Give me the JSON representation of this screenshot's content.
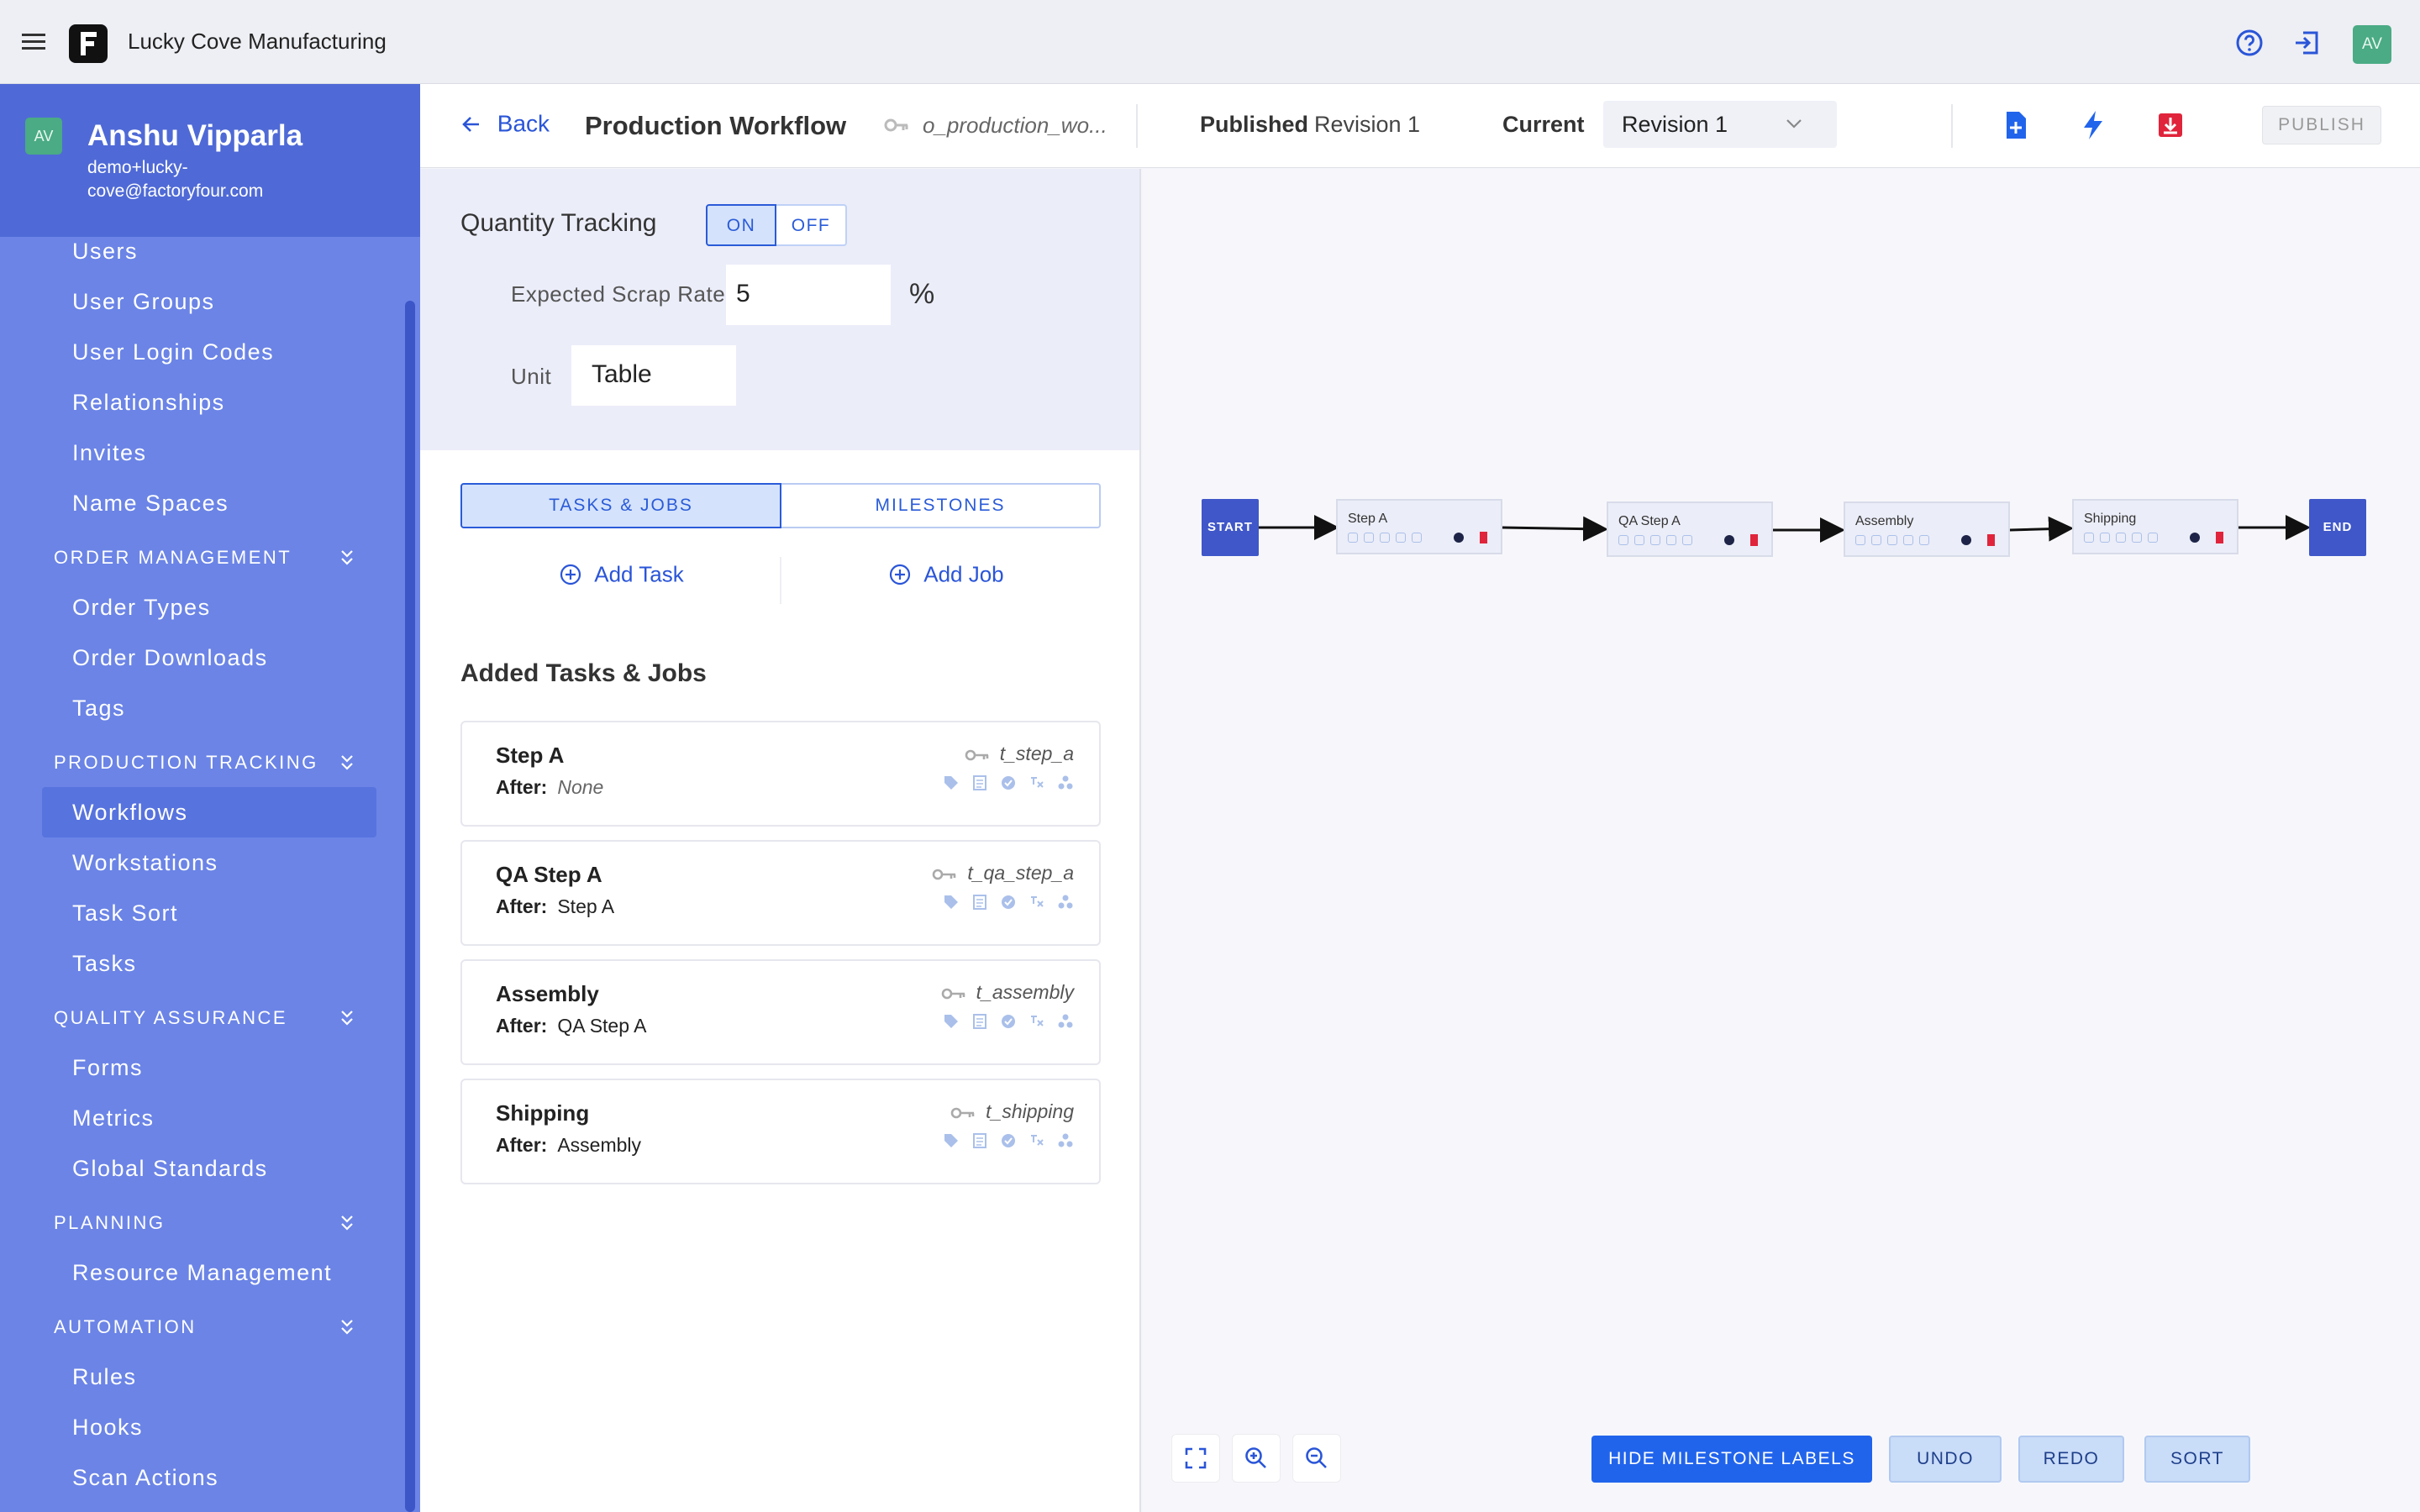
{
  "topbar": {
    "company": "Lucky Cove Manufacturing",
    "logo_letter": "F",
    "avatar_initials": "AV",
    "icons": [
      "hamburger-menu-icon",
      "help-icon",
      "logout-icon"
    ]
  },
  "user": {
    "initials": "AV",
    "name": "Anshu Vipparla",
    "email": "demo+lucky-cove@factoryfour.com"
  },
  "sidebar": {
    "items_top": [
      "Users",
      "User Groups",
      "User Login Codes",
      "Relationships",
      "Invites",
      "Name Spaces"
    ],
    "order_management": {
      "title": "ORDER MANAGEMENT",
      "items": [
        "Order Types",
        "Order Downloads",
        "Tags"
      ]
    },
    "production_tracking": {
      "title": "PRODUCTION TRACKING",
      "items": [
        "Workflows",
        "Workstations",
        "Task Sort",
        "Tasks"
      ],
      "active": "Workflows"
    },
    "quality_assurance": {
      "title": "QUALITY ASSURANCE",
      "items": [
        "Forms",
        "Metrics",
        "Global Standards"
      ]
    },
    "planning": {
      "title": "PLANNING",
      "items": [
        "Resource Management"
      ]
    },
    "automation": {
      "title": "AUTOMATION",
      "items": [
        "Rules",
        "Hooks",
        "Scan Actions"
      ]
    }
  },
  "header": {
    "back_label": "Back",
    "title": "Production Workflow",
    "key": "o_production_wo...",
    "published_label": "Published",
    "published_value": "Revision 1",
    "current_label": "Current",
    "current_value": "Revision 1",
    "publish_label": "PUBLISH",
    "action_icons": [
      "add-document-icon",
      "lightning-icon",
      "download-icon"
    ]
  },
  "quantity_tracking": {
    "label": "Quantity Tracking",
    "on_label": "ON",
    "off_label": "OFF",
    "selected": "ON",
    "scrap_label": "Expected Scrap Rate",
    "scrap_value": "5",
    "scrap_unit": "%",
    "unit_label": "Unit",
    "unit_value": "Table"
  },
  "tabs": {
    "tasks_jobs": "TASKS & JOBS",
    "milestones": "MILESTONES",
    "selected": "TASKS & JOBS"
  },
  "actions": {
    "add_task": "Add Task",
    "add_job": "Add Job"
  },
  "added": {
    "title": "Added Tasks & Jobs",
    "after_label": "After:",
    "items": [
      {
        "name": "Step A",
        "after": "None",
        "key": "t_step_a"
      },
      {
        "name": "QA Step A",
        "after": "Step A",
        "key": "t_qa_step_a"
      },
      {
        "name": "Assembly",
        "after": "QA Step A",
        "key": "t_assembly"
      },
      {
        "name": "Shipping",
        "after": "Assembly",
        "key": "t_shipping"
      }
    ]
  },
  "graph": {
    "start_label": "START",
    "end_label": "END",
    "nodes": [
      "Step A",
      "QA Step A",
      "Assembly",
      "Shipping"
    ]
  },
  "bottom": {
    "hide_milestone_labels": "HIDE MILESTONE LABELS",
    "undo": "UNDO",
    "redo": "REDO",
    "sort": "SORT",
    "zoom_icons": [
      "fit-screen-icon",
      "zoom-in-icon",
      "zoom-out-icon"
    ]
  },
  "colors": {
    "sidebar": "#6b84e6",
    "sidebar_header": "#4f6ad6",
    "accent": "#2a55d8",
    "avatar": "#4aab84",
    "start_end": "#3f57c8"
  }
}
